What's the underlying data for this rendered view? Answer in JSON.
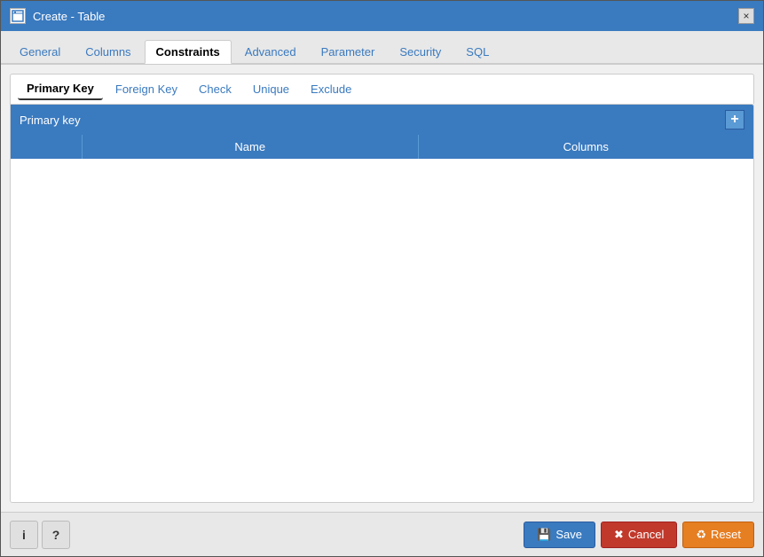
{
  "window": {
    "title": "Create - Table",
    "close_label": "×"
  },
  "nav": {
    "tabs": [
      {
        "id": "general",
        "label": "General",
        "active": false
      },
      {
        "id": "columns",
        "label": "Columns",
        "active": false
      },
      {
        "id": "constraints",
        "label": "Constraints",
        "active": true
      },
      {
        "id": "advanced",
        "label": "Advanced",
        "active": false
      },
      {
        "id": "parameter",
        "label": "Parameter",
        "active": false
      },
      {
        "id": "security",
        "label": "Security",
        "active": false
      },
      {
        "id": "sql",
        "label": "SQL",
        "active": false
      }
    ]
  },
  "sub_tabs": [
    {
      "id": "primary-key",
      "label": "Primary Key",
      "active": true
    },
    {
      "id": "foreign-key",
      "label": "Foreign Key",
      "active": false
    },
    {
      "id": "check",
      "label": "Check",
      "active": false
    },
    {
      "id": "unique",
      "label": "Unique",
      "active": false
    },
    {
      "id": "exclude",
      "label": "Exclude",
      "active": false
    }
  ],
  "panel": {
    "title": "Primary key",
    "add_label": "+"
  },
  "table": {
    "columns": [
      "",
      "Name",
      "Columns"
    ]
  },
  "footer": {
    "info_label": "i",
    "help_label": "?",
    "save_label": "Save",
    "cancel_label": "Cancel",
    "reset_label": "Reset"
  }
}
